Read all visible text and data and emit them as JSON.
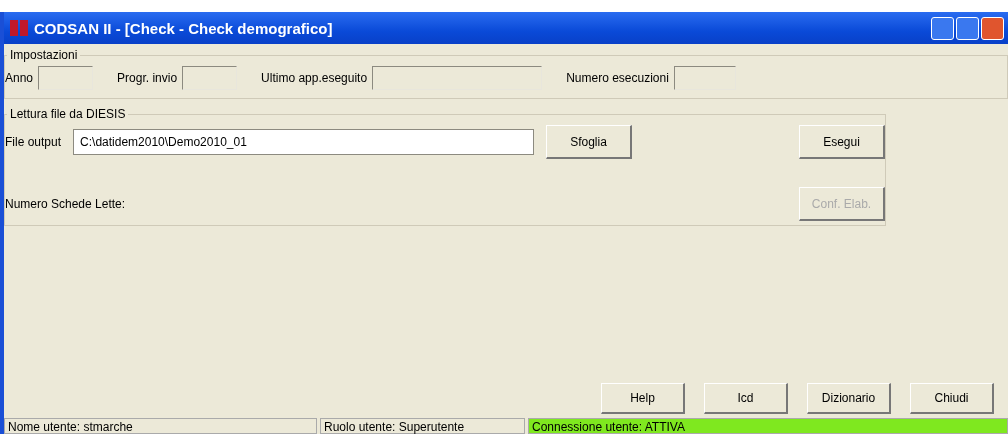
{
  "window": {
    "title": "CODSAN II - [Check - Check demografico]"
  },
  "settings": {
    "legend": "Impostazioni",
    "fields": [
      {
        "label": "Anno"
      },
      {
        "label": "Progr. invio"
      },
      {
        "label": "Ultimo app.eseguito"
      },
      {
        "label": "Numero esecuzioni"
      }
    ]
  },
  "reading": {
    "legend": "Lettura file da DIESIS",
    "file_label": "File output",
    "file_value": "C:\\datidem2010\\Demo2010_01",
    "browse_button": "Sfoglia",
    "run_button": {
      "label": "Esegui",
      "disabled": false
    },
    "records_label": "Numero Schede Lette:",
    "confirm_button": {
      "label": "Conf. Elab.",
      "disabled": true
    }
  },
  "buttons": [
    "Help",
    "Icd",
    "Dizionario",
    "Chiudi"
  ],
  "status_bar": [
    {
      "text": "Nome utente: stmarche",
      "color": "#ece9d8"
    },
    {
      "text": "Ruolo utente: Superutente",
      "color": "#ece9d8"
    },
    {
      "text": "Connessione utente: ATTIVA",
      "color": "#7fe81f"
    }
  ]
}
